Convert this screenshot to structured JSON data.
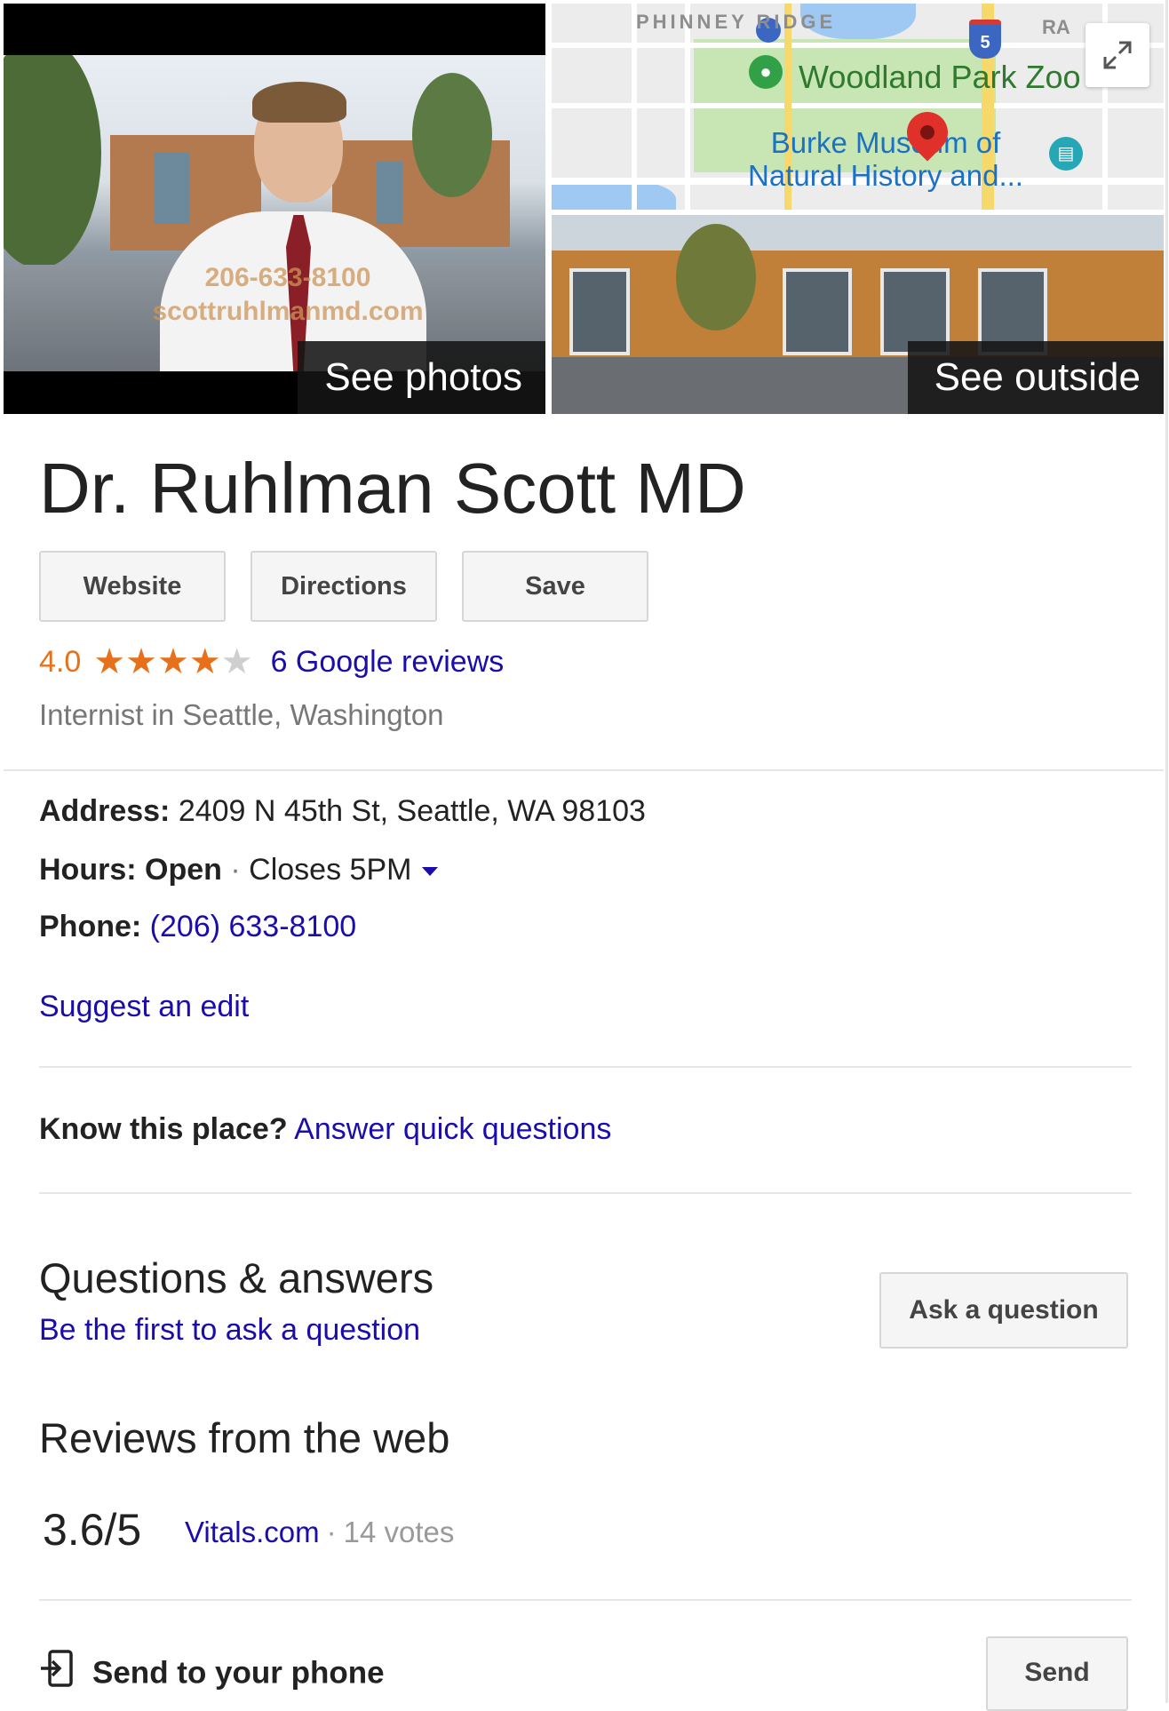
{
  "media": {
    "photos_label": "See photos",
    "outside_label": "See outside",
    "photo_watermark_phone": "206-633-8100",
    "photo_watermark_site": "scottruhlmanmd.com"
  },
  "map": {
    "neighborhood_label": "PHINNEY RIDGE",
    "partial_label": "RA",
    "highway_number": "5",
    "park_label": "Woodland Park Zoo",
    "poi_label": "Burke Museum of Natural History and..."
  },
  "listing": {
    "title": "Dr. Ruhlman Scott MD",
    "actions": [
      "Website",
      "Directions",
      "Save"
    ],
    "rating": "4.0",
    "stars_filled": 4,
    "stars_total": 5,
    "reviews_link": "6 Google reviews",
    "category": "Internist in Seattle, Washington"
  },
  "details": {
    "address_label": "Address:",
    "address_value": "2409 N 45th St, Seattle, WA 98103",
    "hours_label": "Hours:",
    "hours_status": "Open",
    "hours_sep": "·",
    "hours_value": "Closes 5PM",
    "phone_label": "Phone:",
    "phone_value": "(206) 633-8100",
    "suggest_edit": "Suggest an edit"
  },
  "know_place": {
    "prompt": "Know this place?",
    "link": "Answer quick questions"
  },
  "qa": {
    "title": "Questions & answers",
    "subtitle": "Be the first to ask a question",
    "ask_button": "Ask a question"
  },
  "web_reviews": {
    "title": "Reviews from the web",
    "score": "3.6/5",
    "source": "Vitals.com",
    "sep": "·",
    "votes": "14 votes"
  },
  "send": {
    "label": "Send to your phone",
    "button": "Send"
  },
  "colors": {
    "link": "#1a0dab",
    "rating": "#e7711b",
    "stars_off": "#cfcfcf"
  }
}
